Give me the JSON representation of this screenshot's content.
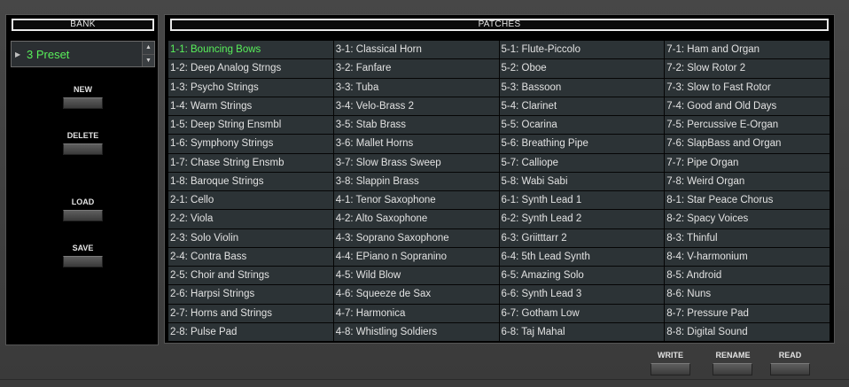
{
  "bank": {
    "header": "BANK",
    "selected": "3 Preset",
    "buttons": {
      "new": "NEW",
      "delete": "DELETE",
      "load": "LOAD",
      "save": "SAVE"
    }
  },
  "patches": {
    "header": "PATCHES",
    "selected": "1-1: Bouncing Bows",
    "columns": [
      [
        "1-1: Bouncing Bows",
        "1-2: Deep Analog Strngs",
        "1-3: Psycho  Strings",
        "1-4: Warm Strings",
        "1-5: Deep String Ensmbl",
        "1-6: Symphony Strings",
        "1-7: Chase String Ensmb",
        "1-8: Baroque Strings",
        "2-1: Cello",
        "2-2: Viola",
        "2-3: Solo Violin",
        "2-4: Contra Bass",
        "2-5: Choir and Strings",
        "2-6: Harpsi Strings",
        "2-7: Horns and Strings",
        "2-8: Pulse Pad"
      ],
      [
        "3-1: Classical Horn",
        "3-2: Fanfare",
        "3-3: Tuba",
        "3-4: Velo-Brass 2",
        "3-5: Stab Brass",
        "3-6: Mallet Horns",
        "3-7: Slow Brass Sweep",
        "3-8: Slappin Brass",
        "4-1: Tenor Saxophone",
        "4-2: Alto Saxophone",
        "4-3: Soprano Saxophone",
        "4-4: EPiano n Sopranino",
        "4-5: Wild Blow",
        "4-6: Squeeze de Sax",
        "4-7: Harmonica",
        "4-8: Whistling Soldiers"
      ],
      [
        "5-1: Flute-Piccolo",
        "5-2: Oboe",
        "5-3: Bassoon",
        "5-4: Clarinet",
        "5-5: Ocarina",
        "5-6: Breathing Pipe",
        "5-7: Calliope",
        "5-8: Wabi Sabi",
        "6-1: Synth Lead 1",
        "6-2: Synth Lead 2",
        "6-3: Griitttarr 2",
        "6-4: 5th Lead Synth",
        "6-5: Amazing Solo",
        "6-6: Synth Lead 3",
        "6-7: Gotham Low",
        "6-8: Taj Mahal"
      ],
      [
        "7-1: Ham and Organ",
        "7-2: Slow Rotor  2",
        "7-3: Slow to Fast Rotor",
        "7-4: Good and Old Days",
        "7-5: Percussive E-Organ",
        "7-6: SlapBass and Organ",
        "7-7: Pipe Organ",
        "7-8: Weird Organ",
        "8-1: Star Peace Chorus",
        "8-2: Spacy Voices",
        "8-3: Thinful",
        "8-4: V-harmonium",
        "8-5: Android",
        "8-6: Nuns",
        "8-7: Pressure Pad",
        "8-8: Digital Sound"
      ]
    ]
  },
  "footer": {
    "write": "WRITE",
    "rename": "RENAME",
    "read": "READ"
  },
  "colors": {
    "selected_text": "#58f05a",
    "cell_bg": "#2c3336",
    "panel_bg": "#000000"
  }
}
